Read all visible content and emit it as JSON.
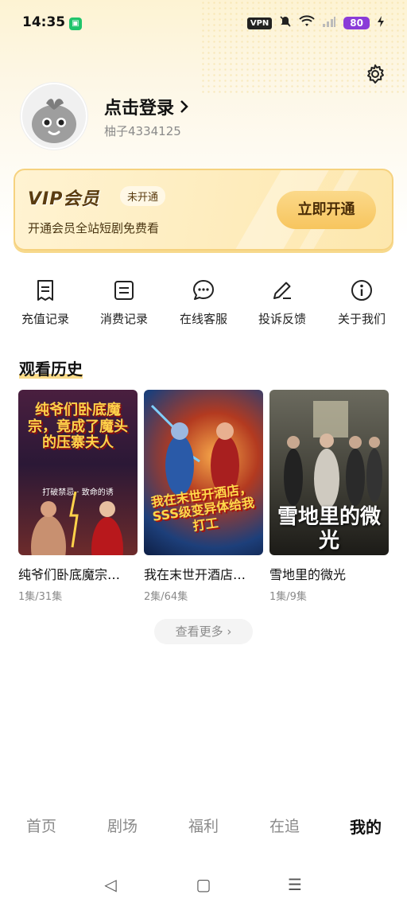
{
  "status_bar": {
    "time": "14:35",
    "vpn": "VPN",
    "battery": "80",
    "icons": [
      "app-notification-icon",
      "mute-icon",
      "wifi-icon",
      "signal-icon",
      "charging-icon"
    ]
  },
  "profile": {
    "login_text": "点击登录",
    "user_id": "柚子4334125"
  },
  "vip": {
    "logo": "VIP会员",
    "status": "未开通",
    "description": "开通会员全站短剧免费看",
    "button": "立即开通"
  },
  "menu": [
    {
      "label": "充值记录",
      "icon": "receipt-icon"
    },
    {
      "label": "消费记录",
      "icon": "document-icon"
    },
    {
      "label": "在线客服",
      "icon": "chat-icon"
    },
    {
      "label": "投诉反馈",
      "icon": "pencil-icon"
    },
    {
      "label": "关于我们",
      "icon": "info-icon"
    }
  ],
  "history": {
    "title": "观看历史",
    "items": [
      {
        "title": "纯爷们卧底魔宗…",
        "episodes": "1集/31集",
        "poster_text": "纯爷们卧底魔宗，竟成了魔头的压寨夫人",
        "poster_sub": "打破禁忌 · 致命的诱"
      },
      {
        "title": "我在末世开酒店…",
        "episodes": "2集/64集",
        "poster_text": "我在末世开酒店，SSS级变异体给我打工"
      },
      {
        "title": "雪地里的微光",
        "episodes": "1集/9集",
        "poster_text": "雪地里的微光"
      }
    ],
    "more": "查看更多"
  },
  "tabs": [
    {
      "label": "首页",
      "active": false
    },
    {
      "label": "剧场",
      "active": false
    },
    {
      "label": "福利",
      "active": false
    },
    {
      "label": "在追",
      "active": false
    },
    {
      "label": "我的",
      "active": true
    }
  ],
  "nav": [
    "◁",
    "▢",
    "☰"
  ]
}
